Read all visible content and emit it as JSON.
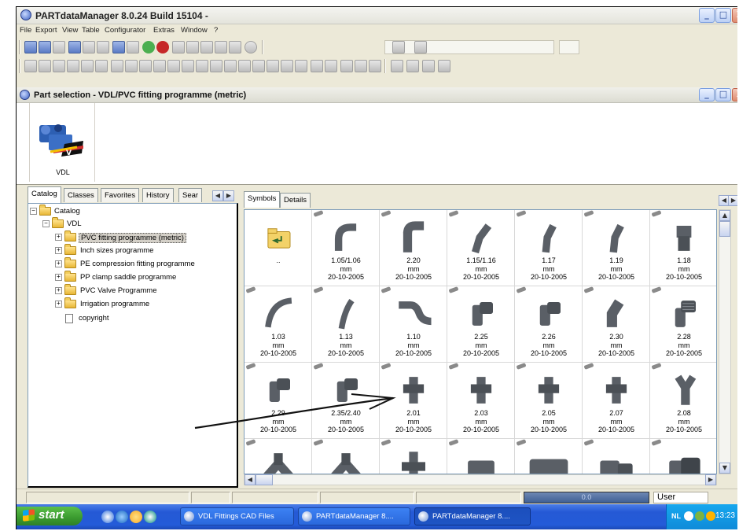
{
  "app": {
    "title": "PARTdataManager 8.0.24 Build 15104 -",
    "menu": [
      "File",
      "Export",
      "View",
      "Table",
      "Configurator",
      "Extras",
      "Window",
      "?"
    ],
    "window_buttons": {
      "minimize": "_",
      "maximize": "□",
      "close": "X"
    }
  },
  "inner_window": {
    "title": "Part selection  -  VDL/PVC fitting programme (metric)"
  },
  "catalog_strip": {
    "logo_label": "VDL"
  },
  "left_panel": {
    "tabs": [
      "Catalog",
      "Classes",
      "Favorites",
      "History",
      "Sear"
    ],
    "active_tab": "Catalog",
    "tree": [
      {
        "label": "Catalog",
        "level": 0,
        "expander": "−",
        "icon": "folder-open"
      },
      {
        "label": "VDL",
        "level": 1,
        "expander": "−",
        "icon": "folder-open"
      },
      {
        "label": "PVC fitting programme (metric)",
        "level": 2,
        "expander": "+",
        "icon": "folder",
        "selected": true
      },
      {
        "label": "Inch sizes programme",
        "level": 2,
        "expander": "+",
        "icon": "folder"
      },
      {
        "label": "PE compression fitting programme",
        "level": 2,
        "expander": "+",
        "icon": "folder"
      },
      {
        "label": "PP clamp saddle programme",
        "level": 2,
        "expander": "+",
        "icon": "folder"
      },
      {
        "label": "PVC Valve Programme",
        "level": 2,
        "expander": "+",
        "icon": "folder"
      },
      {
        "label": "Irrigation programme",
        "level": 2,
        "expander": "+",
        "icon": "folder"
      },
      {
        "label": "copyright",
        "level": 2,
        "expander": "",
        "icon": "document"
      }
    ]
  },
  "right_panel": {
    "tabs": [
      "Symbols",
      "Details"
    ],
    "active_tab": "Symbols",
    "items": [
      {
        "lines": [
          "..",
          "",
          ""
        ],
        "shape": "folder-up"
      },
      {
        "lines": [
          "1.05/1.06",
          "mm",
          "20-10-2005"
        ],
        "shape": "bend-90"
      },
      {
        "lines": [
          "2.20",
          "mm",
          "20-10-2005"
        ],
        "shape": "elbow-90"
      },
      {
        "lines": [
          "1.15/1.16",
          "mm",
          "20-10-2005"
        ],
        "shape": "bend-45"
      },
      {
        "lines": [
          "1.17",
          "mm",
          "20-10-2005"
        ],
        "shape": "bend-30"
      },
      {
        "lines": [
          "1.19",
          "mm",
          "20-10-2005"
        ],
        "shape": "bend-30"
      },
      {
        "lines": [
          "1.18",
          "mm",
          "20-10-2005"
        ],
        "shape": "reducer"
      },
      {
        "lines": [
          "1.03",
          "mm",
          "20-10-2005"
        ],
        "shape": "long-bend"
      },
      {
        "lines": [
          "1.13",
          "mm",
          "20-10-2005"
        ],
        "shape": "long-bend-45"
      },
      {
        "lines": [
          "1.10",
          "mm",
          "20-10-2005"
        ],
        "shape": "swan-neck"
      },
      {
        "lines": [
          "2.25",
          "mm",
          "20-10-2005"
        ],
        "shape": "elbow"
      },
      {
        "lines": [
          "2.26",
          "mm",
          "20-10-2005"
        ],
        "shape": "elbow"
      },
      {
        "lines": [
          "2.30",
          "mm",
          "20-10-2005"
        ],
        "shape": "elbow-45"
      },
      {
        "lines": [
          "2.28",
          "mm",
          "20-10-2005"
        ],
        "shape": "threaded-elbow"
      },
      {
        "lines": [
          "2.29",
          "mm",
          "20-10-2005"
        ],
        "shape": "elbow"
      },
      {
        "lines": [
          "2.35/2.40",
          "mm",
          "20-10-2005"
        ],
        "shape": "elbow"
      },
      {
        "lines": [
          "2.01",
          "mm",
          "20-10-2005"
        ],
        "shape": "tee"
      },
      {
        "lines": [
          "2.03",
          "mm",
          "20-10-2005"
        ],
        "shape": "tee"
      },
      {
        "lines": [
          "2.05",
          "mm",
          "20-10-2005"
        ],
        "shape": "tee"
      },
      {
        "lines": [
          "2.07",
          "mm",
          "20-10-2005"
        ],
        "shape": "tee"
      },
      {
        "lines": [
          "2.08",
          "mm",
          "20-10-2005"
        ],
        "shape": "y-tee"
      },
      {
        "lines": [
          "",
          "",
          ""
        ],
        "shape": "wye"
      },
      {
        "lines": [
          "",
          "",
          ""
        ],
        "shape": "wye"
      },
      {
        "lines": [
          "",
          "",
          ""
        ],
        "shape": "cross"
      },
      {
        "lines": [
          "",
          "",
          ""
        ],
        "shape": "socket"
      },
      {
        "lines": [
          "",
          "",
          ""
        ],
        "shape": "socket-long"
      },
      {
        "lines": [
          "",
          "",
          ""
        ],
        "shape": "reducer-socket"
      },
      {
        "lines": [
          "",
          "",
          ""
        ],
        "shape": "adaptor"
      }
    ]
  },
  "statusbar": {
    "progress_text": "0.0",
    "user_label": "User"
  },
  "taskbar": {
    "start_label": "start",
    "buttons": [
      "VDL Fittings CAD Files",
      "PARTdataManager 8....",
      "PARTdataManager 8...."
    ],
    "active_index": 2,
    "tray": {
      "language": "NL",
      "clock": "13:23"
    }
  },
  "colors": {
    "window_bg": "#ece9d8",
    "taskbar_blue": "#245bd8",
    "start_green": "#3a9a2f",
    "progress_blue": "#3f5f94",
    "part_gray": "#5a5f66"
  }
}
